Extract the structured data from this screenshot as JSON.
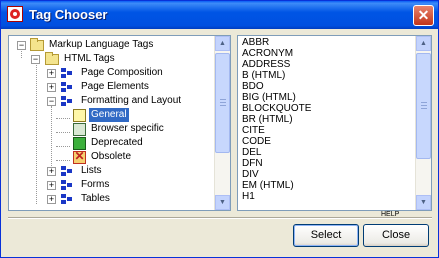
{
  "window": {
    "title": "Tag Chooser"
  },
  "tree": {
    "root": "Markup Language Tags",
    "html_tags": "HTML Tags",
    "page_composition": "Page Composition",
    "page_elements": "Page Elements",
    "formatting_layout": "Formatting and Layout",
    "general": "General",
    "browser_specific": "Browser specific",
    "deprecated": "Deprecated",
    "obsolete": "Obsolete",
    "lists": "Lists",
    "forms": "Forms",
    "tables": "Tables"
  },
  "tag_list": [
    "ABBR",
    "ACRONYM",
    "ADDRESS",
    "B (HTML)",
    "BDO",
    "BIG (HTML)",
    "BLOCKQUOTE",
    "BR (HTML)",
    "CITE",
    "CODE",
    "DEL",
    "DFN",
    "DIV",
    "EM (HTML)",
    "H1"
  ],
  "help_hint": "HELP",
  "buttons": {
    "select": "Select",
    "close": "Close"
  }
}
